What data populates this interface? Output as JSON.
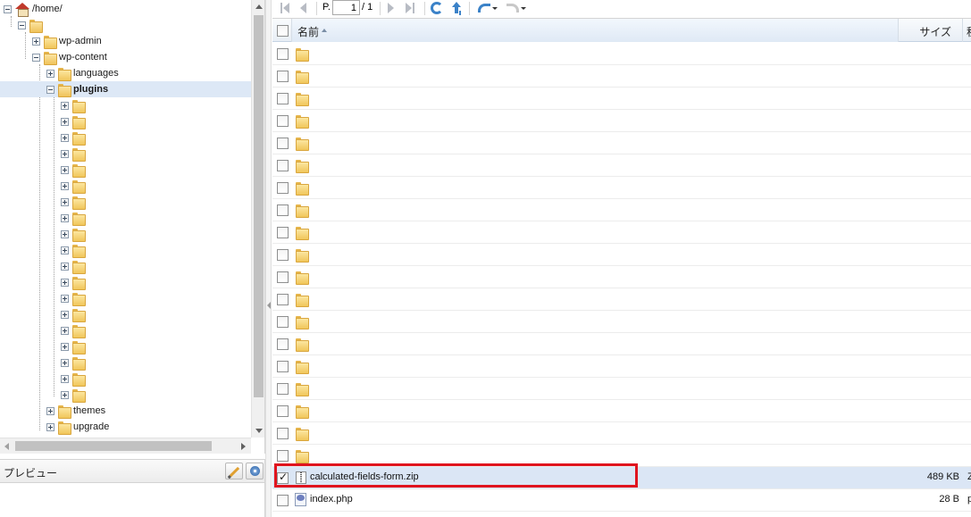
{
  "tree": {
    "root_label": "/home/",
    "user_folder_label": "",
    "wp_admin": "wp-admin",
    "wp_content": "wp-content",
    "languages": "languages",
    "plugins": "plugins",
    "plugin_folder_count": 19,
    "themes": "themes",
    "upgrade": "upgrade"
  },
  "preview": {
    "title": "プレビュー",
    "edit_icon": "pencil-icon",
    "save_icon": "disk-icon"
  },
  "toolbar": {
    "page_prefix": "P.",
    "page_value": "1",
    "page_total": "/ 1",
    "icons": [
      "first-page-icon",
      "prev-page-icon",
      "next-page-icon",
      "last-page-icon",
      "refresh-icon",
      "up-folder-icon",
      "undo-icon",
      "redo-icon"
    ]
  },
  "grid": {
    "columns": {
      "name": "名前",
      "size": "サイズ",
      "type": "種"
    },
    "folder_rows": 19,
    "rows": [
      {
        "name": "calculated-fields-form.zip",
        "size": "489 KB",
        "type": "Z",
        "checked": true,
        "icon": "zip-icon"
      },
      {
        "name": "index.php",
        "size": "28 B",
        "type": "p",
        "checked": false,
        "icon": "php-icon"
      }
    ]
  },
  "colors": {
    "highlight_border": "#e0141e",
    "selection_background": "#dbe6f5",
    "folder": "#f1c65a"
  }
}
